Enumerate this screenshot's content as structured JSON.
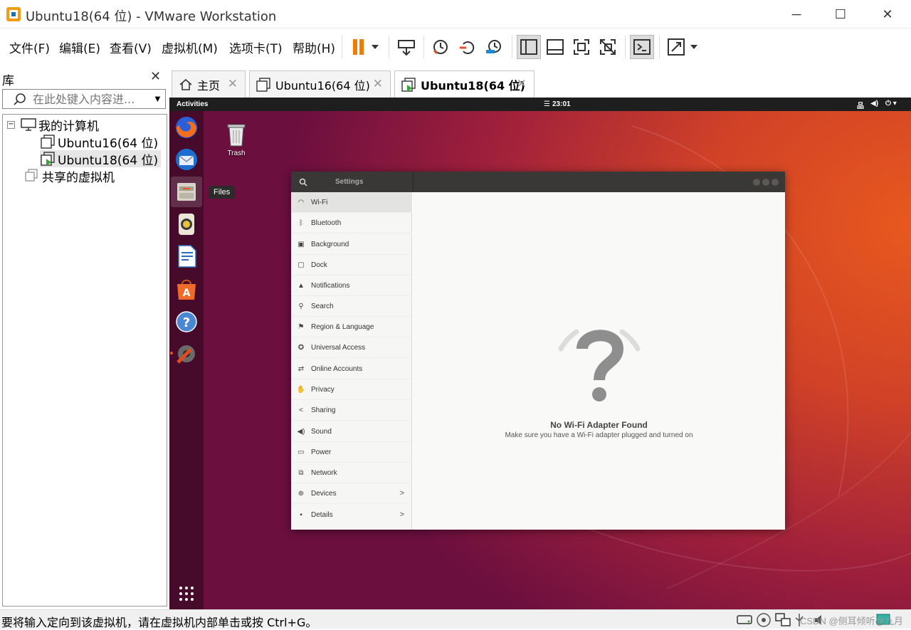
{
  "window": {
    "title": "Ubuntu18(64 位) - VMware Workstation"
  },
  "menu": [
    "文件(F)",
    "编辑(E)",
    "查看(V)",
    "虚拟机(M)",
    "选项卡(T)",
    "帮助(H)"
  ],
  "library": {
    "title": "库",
    "search_placeholder": "在此处键入内容进...",
    "tree": {
      "root": "我的计算机",
      "vm1": "Ubuntu16(64 位)",
      "vm2": "Ubuntu18(64 位)",
      "shared": "共享的虚拟机"
    }
  },
  "tabs": {
    "home": "主页",
    "vm1": "Ubuntu16(64 位)",
    "vm2": "Ubuntu18(64 位)"
  },
  "guest": {
    "activities": "Activities",
    "clock": "23:01",
    "trash_label": "Trash",
    "files_tooltip": "Files",
    "settings": {
      "title": "Settings",
      "items": [
        "Wi-Fi",
        "Bluetooth",
        "Background",
        "Dock",
        "Notifications",
        "Search",
        "Region & Language",
        "Universal Access",
        "Online Accounts",
        "Privacy",
        "Sharing",
        "Sound",
        "Power",
        "Network",
        "Devices",
        "Details"
      ],
      "empty_title": "No Wi-Fi Adapter Found",
      "empty_subtitle": "Make sure you have a Wi-Fi adapter plugged and turned on"
    }
  },
  "status": {
    "message": "要将输入定向到该虚拟机，请在虚拟机内部单击或按 Ctrl+G。",
    "watermark": "CSDN @侧耳倾听@九月"
  },
  "colors": {
    "accent_orange": "#e9591e",
    "aubergine": "#6b0f3f",
    "pause_orange": "#f07c00"
  }
}
